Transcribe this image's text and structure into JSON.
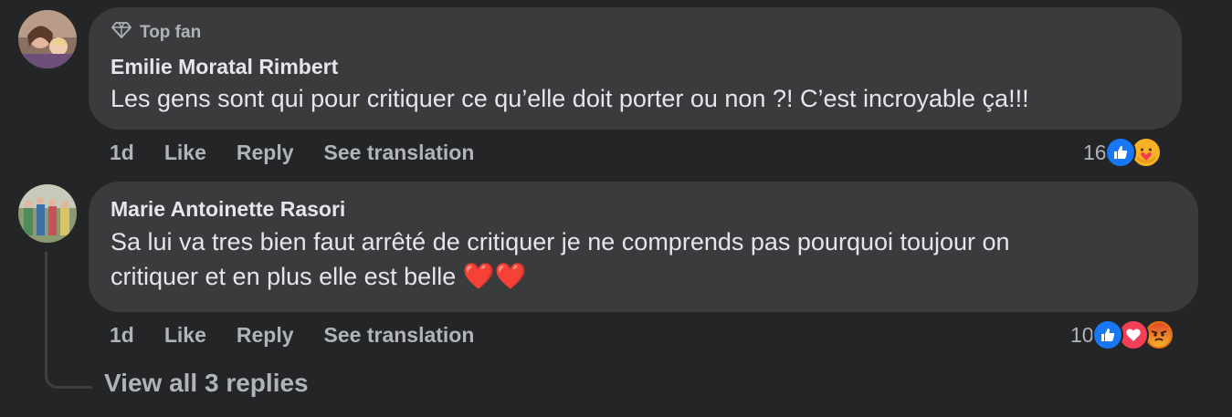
{
  "comments": [
    {
      "badge": "Top fan",
      "author": "Emilie Moratal Rimbert",
      "text": "Les gens sont qui pour critiquer ce qu’elle doit porter ou non ?! C’est incroyable ça!!!",
      "time": "1d",
      "like": "Like",
      "reply": "Reply",
      "translate": "See translation",
      "reaction_count": "16",
      "reactions": [
        "like-icon",
        "care-icon"
      ]
    },
    {
      "author": "Marie Antoinette Rasori",
      "text_line1": "Sa lui va tres bien faut arrêté de critiquer je ne comprends pas pourquoi toujour on",
      "text_line2": "critiquer et en plus elle est belle ",
      "emoji": "❤️❤️",
      "time": "1d",
      "like": "Like",
      "reply": "Reply",
      "translate": "See translation",
      "reaction_count": "10",
      "reactions": [
        "like-icon",
        "love-icon",
        "angry-icon"
      ]
    }
  ],
  "view_replies": "View all 3 replies",
  "colors": {
    "background": "#242526",
    "bubble": "#3a3b3c",
    "like_blue": "#1877f2",
    "love_red": "#f33e58"
  }
}
